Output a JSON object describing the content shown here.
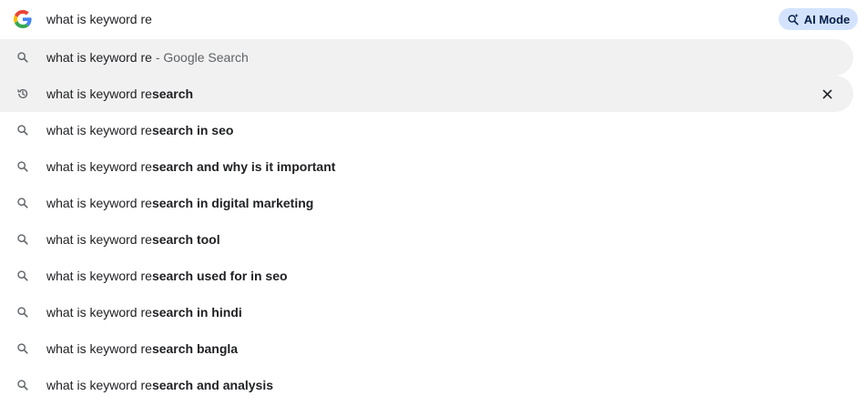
{
  "omnibox": {
    "query": "what is keyword re",
    "ai_mode_label": "AI Mode"
  },
  "first_suggestion": {
    "query": "what is keyword re",
    "suffix": " - Google Search"
  },
  "suggestions": [
    {
      "type": "history",
      "typed": "what is keyword re",
      "completion": "search"
    },
    {
      "type": "search",
      "typed": "what is keyword re",
      "completion": "search in seo"
    },
    {
      "type": "search",
      "typed": "what is keyword re",
      "completion": "search and why is it important"
    },
    {
      "type": "search",
      "typed": "what is keyword re",
      "completion": "search in digital marketing"
    },
    {
      "type": "search",
      "typed": "what is keyword re",
      "completion": "search tool"
    },
    {
      "type": "search",
      "typed": "what is keyword re",
      "completion": "search used for in seo"
    },
    {
      "type": "search",
      "typed": "what is keyword re",
      "completion": "search in hindi"
    },
    {
      "type": "search",
      "typed": "what is keyword re",
      "completion": "search bangla"
    },
    {
      "type": "search",
      "typed": "what is keyword re",
      "completion": "search and analysis"
    }
  ],
  "colors": {
    "highlight": "#f1f1f1",
    "ai_mode_bg": "#d3e3fd",
    "icon": "#5f6368"
  }
}
